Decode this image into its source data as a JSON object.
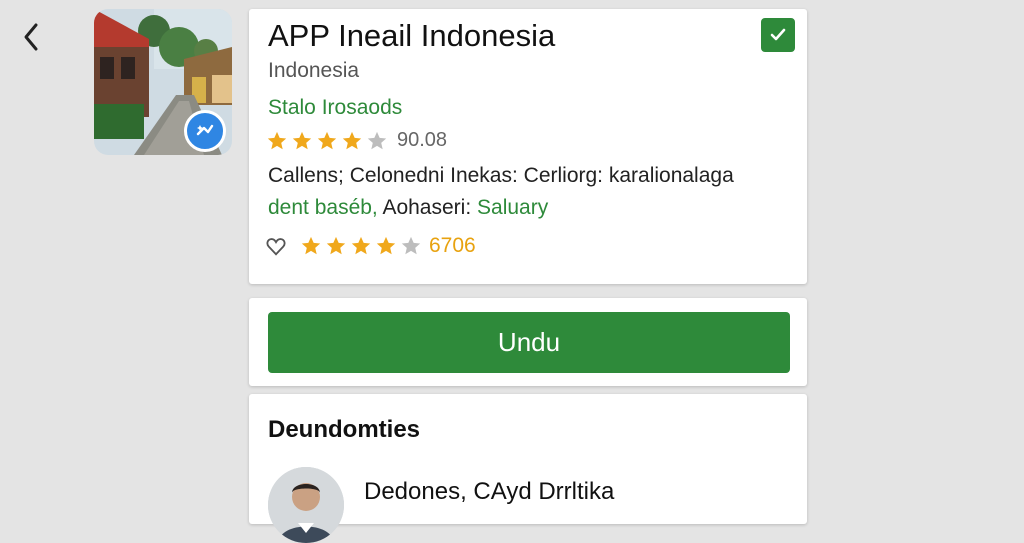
{
  "app": {
    "title": "APP Ineail Indonesia",
    "subtitle": "Indonesia",
    "developer": "Stalo Irosaods",
    "rating_text": "90.08",
    "rating_stars": 4,
    "description_line1": "Callens; Celonedni Inekas: Cerliorg: karalionalaga",
    "description_line2_green1": "dent baséb,",
    "description_line2_black": " Aohaseri:",
    "description_line2_green2": " Saluary"
  },
  "favorites": {
    "stars": 4,
    "count_text": "6706"
  },
  "install_button": {
    "label": "Undu"
  },
  "developers_section": {
    "title": "Deundomties",
    "person_name": "Dedones, CAyd Drrltika"
  },
  "colors": {
    "accent_green": "#2e8a3a",
    "star_gold": "#f0a81c",
    "badge_blue": "#2f86e3"
  },
  "icons": {
    "back": "chevron-left-icon",
    "check": "check-icon",
    "badge": "sparkle-icon",
    "favorite": "heart-outline-icon",
    "star": "star-icon"
  }
}
